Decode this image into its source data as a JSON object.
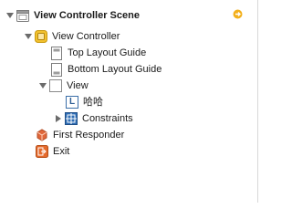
{
  "scene": {
    "title": "View Controller Scene",
    "icon": "scene-icon",
    "expanded": true,
    "indicator_icon": "scene-status-indicator-icon",
    "indicator_color": "#f3b01c"
  },
  "tree": {
    "view_controller": {
      "label": "View Controller",
      "icon": "view-controller-icon",
      "expanded": true
    },
    "top_layout_guide": {
      "label": "Top Layout Guide",
      "icon": "layout-guide-icon"
    },
    "bottom_layout_guide": {
      "label": "Bottom Layout Guide",
      "icon": "layout-guide-icon"
    },
    "view": {
      "label": "View",
      "icon": "view-icon",
      "expanded": true
    },
    "label_item": {
      "label": "哈哈",
      "icon": "label-icon",
      "icon_glyph": "L"
    },
    "constraints": {
      "label": "Constraints",
      "icon": "constraints-icon",
      "expanded": false
    },
    "first_responder": {
      "label": "First Responder",
      "icon": "first-responder-icon"
    },
    "exit": {
      "label": "Exit",
      "icon": "exit-icon"
    }
  },
  "colors": {
    "view_controller_yellow": "#f2c12e",
    "constraints_blue": "#2f6eb5",
    "first_responder_orange": "#e0673a",
    "exit_orange": "#e46a2c"
  }
}
